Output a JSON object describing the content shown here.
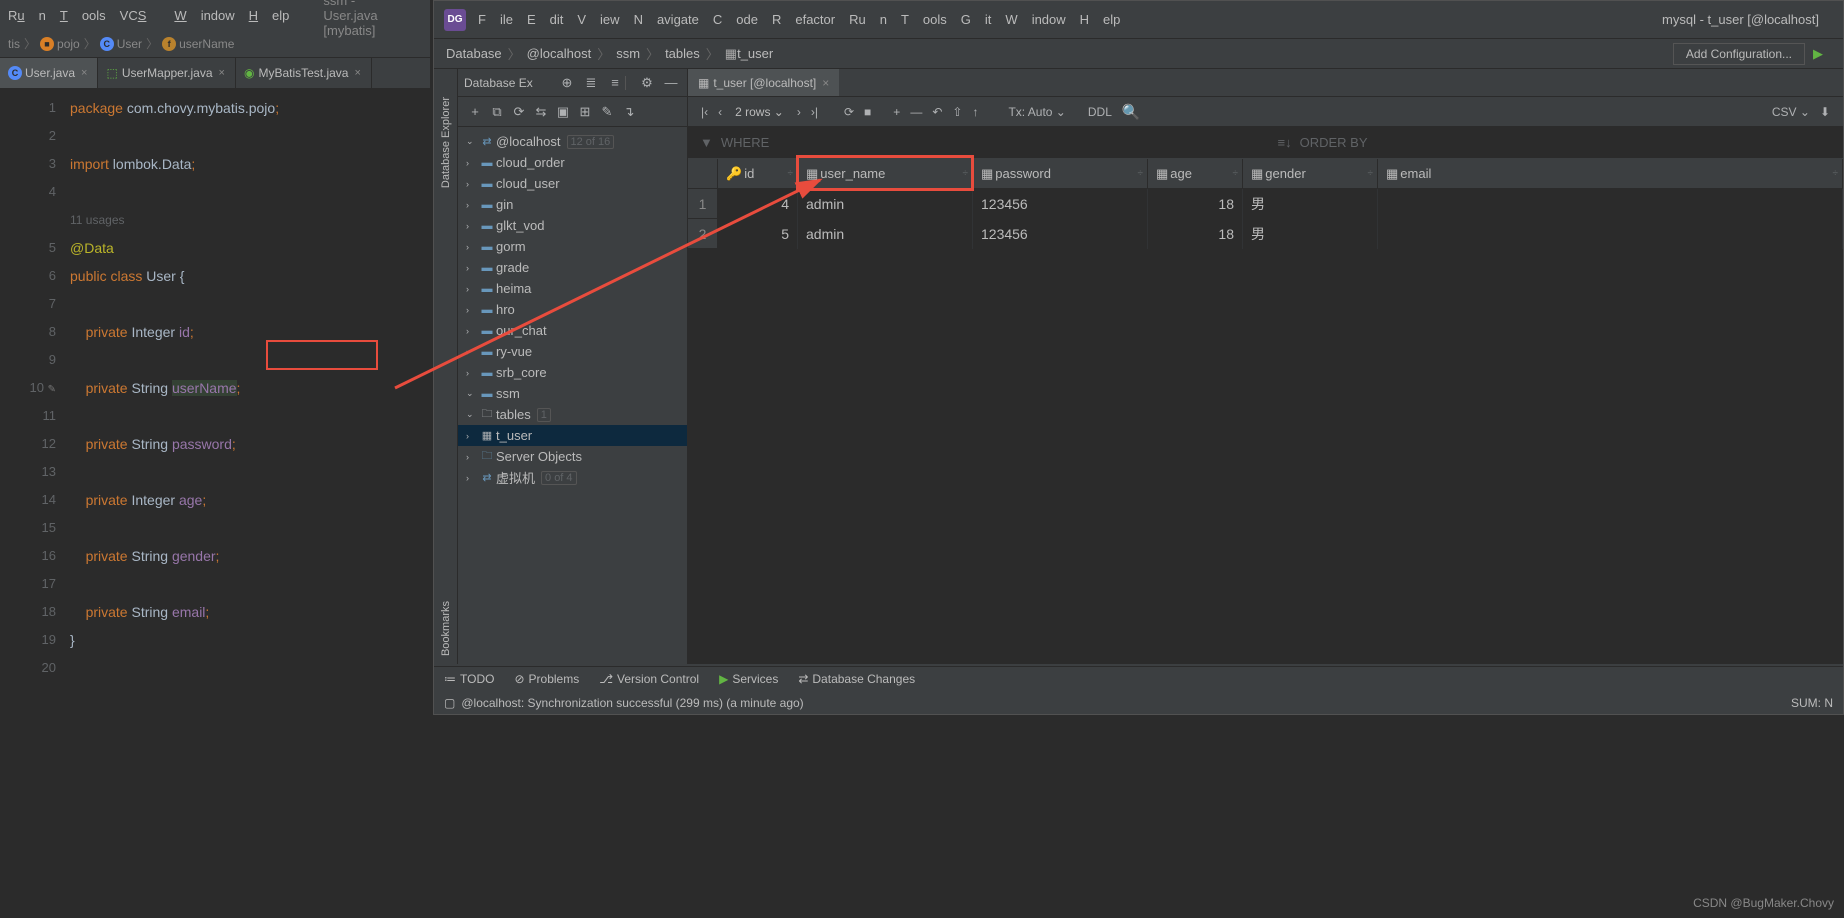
{
  "left": {
    "menu": [
      "un",
      "Tools",
      "VCS",
      "Window",
      "Help"
    ],
    "title": "ssm - User.java [mybatis]",
    "breadcrumb": [
      "tis",
      "pojo",
      "User",
      "userName"
    ],
    "tabs": [
      {
        "label": "User.java",
        "active": true,
        "iconColor": "#548AF7"
      },
      {
        "label": "UserMapper.java",
        "active": false,
        "iconColor": "#62B543"
      },
      {
        "label": "MyBatisTest.java",
        "active": false,
        "iconColor": "#62B543"
      }
    ],
    "code": {
      "lines": [
        1,
        2,
        3,
        4,
        "",
        5,
        6,
        7,
        8,
        9,
        10,
        11,
        12,
        13,
        14,
        15,
        16,
        17,
        18,
        19,
        20
      ],
      "package": "package com.chovy.mybatis.pojo;",
      "import": "import lombok.Data;",
      "usages": "11 usages",
      "atdata": "@Data",
      "classdecl": "public class User {",
      "fields": [
        {
          "type": "Integer",
          "name": "id"
        },
        {
          "type": "String",
          "name": "userName"
        },
        {
          "type": "String",
          "name": "password"
        },
        {
          "type": "Integer",
          "name": "age"
        },
        {
          "type": "String",
          "name": "gender"
        },
        {
          "type": "String",
          "name": "email"
        }
      ]
    }
  },
  "right": {
    "menu": [
      "File",
      "Edit",
      "View",
      "Navigate",
      "Code",
      "Refactor",
      "Run",
      "Tools",
      "Git",
      "Window",
      "Help"
    ],
    "title": "mysql - t_user [@localhost]",
    "breadcrumb": [
      "Database",
      "@localhost",
      "ssm",
      "tables",
      "t_user"
    ],
    "addConfig": "Add Configuration...",
    "dbPanel": {
      "title": "Database Ex",
      "host": "@localhost",
      "hostCount": "12 of 16",
      "schemas": [
        "cloud_order",
        "cloud_user",
        "gin",
        "glkt_vod",
        "gorm",
        "grade",
        "heima",
        "hro",
        "our_chat",
        "ry-vue",
        "srb_core"
      ],
      "ssm": "ssm",
      "tables": "tables",
      "tablesCount": "1",
      "t_user": "t_user",
      "serverObjects": "Server Objects",
      "vm": "虚拟机",
      "vmCount": "0 of 4"
    },
    "sideRail": [
      "Database Explorer",
      "Bookmarks"
    ],
    "mainTab": "t_user [@localhost]",
    "rows": "2 rows",
    "txAuto": "Tx: Auto",
    "ddl": "DDL",
    "csv": "CSV",
    "where": "WHERE",
    "orderby": "ORDER BY",
    "columns": [
      "id",
      "user_name",
      "password",
      "age",
      "gender",
      "email"
    ],
    "data": [
      {
        "id": 4,
        "user_name": "admin",
        "password": "123456",
        "age": 18,
        "gender": "男",
        "email": ""
      },
      {
        "id": 5,
        "user_name": "admin",
        "password": "123456",
        "age": 18,
        "gender": "男",
        "email": ""
      }
    ],
    "statusTop": [
      "TODO",
      "Problems",
      "Version Control",
      "Services",
      "Database Changes"
    ],
    "statusMsg": "@localhost: Synchronization successful (299 ms) (a minute ago)",
    "sum": "SUM: N"
  },
  "watermark": "CSDN @BugMaker.Chovy"
}
